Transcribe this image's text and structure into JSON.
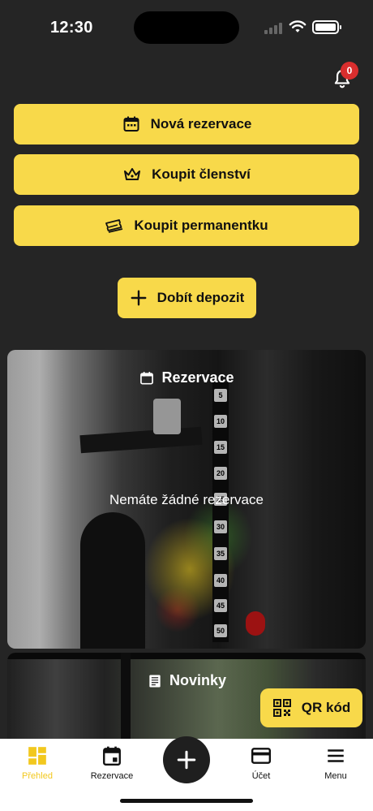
{
  "status_bar": {
    "time": "12:30"
  },
  "notifications": {
    "count": "0",
    "icon": "bell-icon"
  },
  "actions": {
    "new_reservation": "Nová rezervace",
    "buy_membership": "Koupit členství",
    "buy_pass": "Koupit permanentku",
    "top_up_deposit": "Dobít depozit"
  },
  "reservations_card": {
    "title": "Rezervace",
    "empty_text": "Nemáte žádné rezervace",
    "scale_numbers": [
      "5",
      "10",
      "15",
      "20",
      "25",
      "30",
      "35",
      "40",
      "45",
      "50"
    ]
  },
  "news_card": {
    "title": "Novinky"
  },
  "qr_button": {
    "label": "QR kód"
  },
  "bottom_nav": {
    "items": [
      {
        "label": "Přehled",
        "icon": "dashboard-icon"
      },
      {
        "label": "Rezervace",
        "icon": "calendar-icon"
      },
      {
        "label": "Účet",
        "icon": "credit-card-icon"
      },
      {
        "label": "Menu",
        "icon": "hamburger-icon"
      }
    ],
    "fab_icon": "plus-icon"
  },
  "colors": {
    "background": "#252525",
    "accent": "#f8d94a",
    "active_nav": "#f2c81e",
    "badge": "#d92e2e"
  }
}
